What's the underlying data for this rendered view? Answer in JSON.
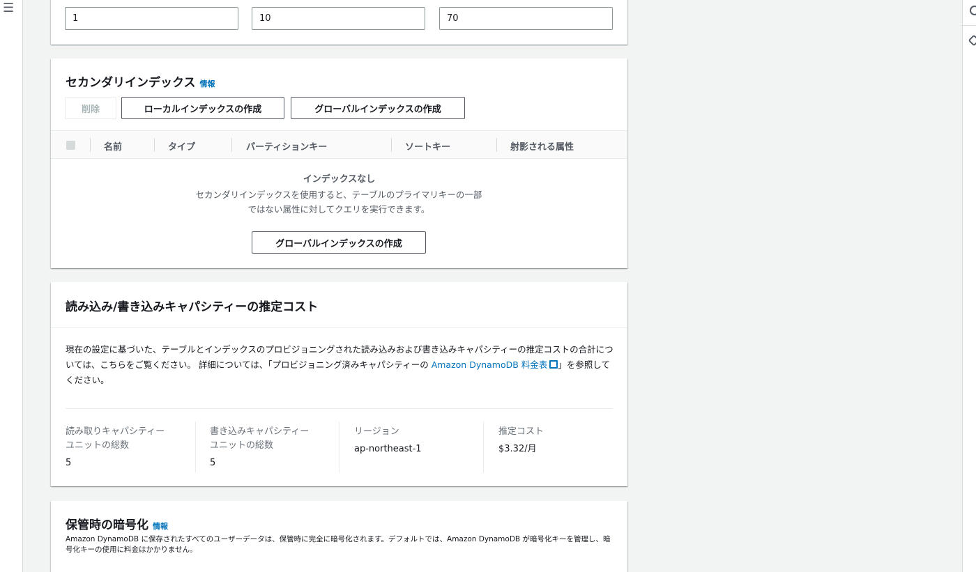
{
  "capacity_inputs": {
    "min_units": "1",
    "max_units": "10",
    "target_utilization": "70"
  },
  "secondary_indexes": {
    "title": "セカンダリインデックス",
    "info": "情報",
    "delete_label": "削除",
    "create_local_label": "ローカルインデックスの作成",
    "create_global_label": "グローバルインデックスの作成",
    "columns": [
      "名前",
      "タイプ",
      "パーティションキー",
      "ソートキー",
      "射影される属性"
    ],
    "empty_title": "インデックスなし",
    "empty_desc": "セカンダリインデックスを使用すると、テーブルのプライマリキーの一部ではない属性に対してクエリを実行できます。",
    "empty_create_global_label": "グローバルインデックスの作成"
  },
  "cost": {
    "title": "読み込み/書き込みキャパシティーの推定コスト",
    "desc_before": "現在の設定に基づいた、テーブルとインデックスのプロビジョニングされた読み込みおよび書き込みキャパシティーの推定コストの合計については、こちらをご覧ください。 詳細については、「プロビジョニング済みキャパシティーの ",
    "desc_link": "Amazon DynamoDB 料金表",
    "desc_after": "」を参照してください。",
    "read_units_label_1": "読み取りキャパシティー",
    "read_units_label_2": "ユニットの総数",
    "read_units_value": "5",
    "write_units_label_1": "書き込みキャパシティー",
    "write_units_label_2": "ユニットの総数",
    "write_units_value": "5",
    "region_label": "リージョン",
    "region_value": "ap-northeast-1",
    "estimated_cost_label": "推定コスト",
    "estimated_cost_value": "$3.32/月"
  },
  "encryption": {
    "title": "保管時の暗号化",
    "info": "情報",
    "desc": "Amazon DynamoDB に保存されたすべてのユーザーデータは、保管時に完全に暗号化されます。デフォルトでは、Amazon DynamoDB が暗号化キーを管理し、暗号化キーの使用に料金はかかりません。"
  },
  "colors": {
    "link": "#0073bb",
    "border": "#545b64",
    "background": "#f2f3f3"
  }
}
